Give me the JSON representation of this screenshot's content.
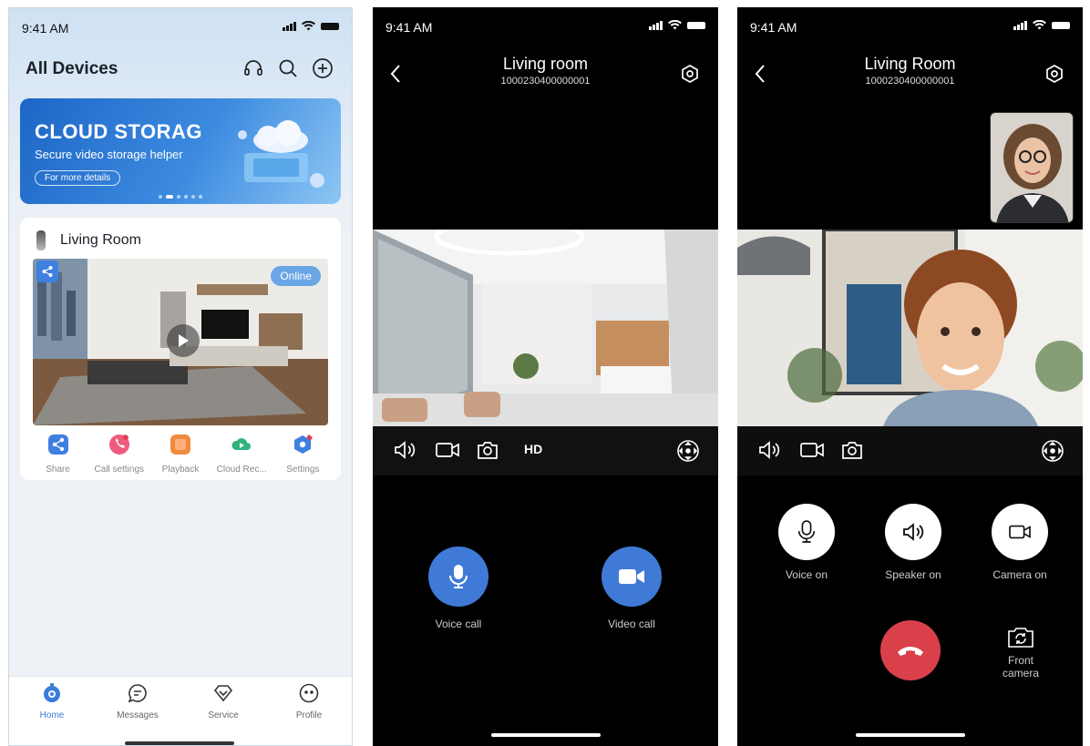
{
  "status": {
    "time": "9:41 AM"
  },
  "home": {
    "title": "All Devices",
    "banner": {
      "title": "CLOUD STORAG",
      "subtitle": "Secure video storage helper",
      "button": "For more details"
    },
    "device": {
      "name": "Living Room",
      "badge": "Online"
    },
    "actions": [
      {
        "label": "Share",
        "icon": "share-icon",
        "color": "#3f7fe0"
      },
      {
        "label": "Call settings",
        "icon": "call-settings-icon",
        "color": "#ef5b7e"
      },
      {
        "label": "Playback",
        "icon": "playback-icon",
        "color": "#f08a3c"
      },
      {
        "label": "Cloud Rec...",
        "icon": "cloud-rec-icon",
        "color": "#2fb37a"
      },
      {
        "label": "Settings",
        "icon": "settings-icon",
        "color": "#3f7fe0"
      }
    ],
    "tabs": [
      {
        "label": "Home",
        "icon": "home-icon",
        "active": true
      },
      {
        "label": "Messages",
        "icon": "messages-icon"
      },
      {
        "label": "Service",
        "icon": "service-icon"
      },
      {
        "label": "Profile",
        "icon": "profile-icon"
      }
    ]
  },
  "live": {
    "title": "Living room",
    "device_id": "1000230400000001",
    "quality": "HD",
    "voice_call": "Voice call",
    "video_call": "Video call"
  },
  "call": {
    "title": "Living Room",
    "device_id": "1000230400000001",
    "voice": "Voice on",
    "speaker": "Speaker on",
    "camera": "Camera on",
    "front_camera": "Front\ncamera"
  },
  "colors": {
    "accent": "#3f7ad6",
    "end_call": "#d9404a"
  }
}
